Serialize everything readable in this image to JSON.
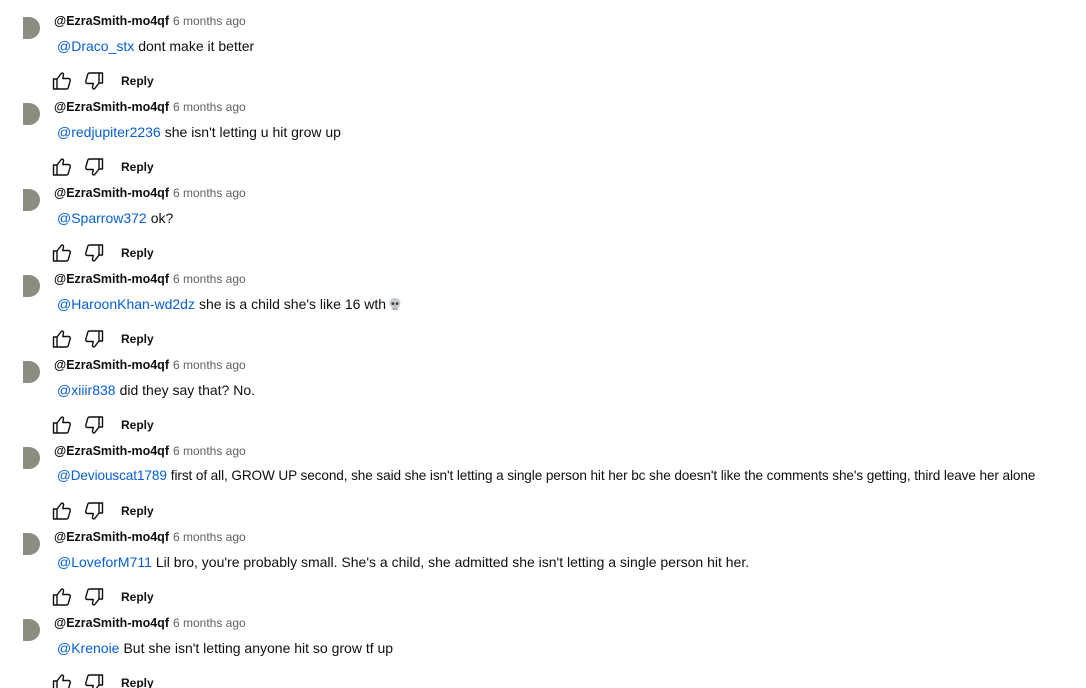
{
  "comments": [
    {
      "author": "@EzraSmith-mo4qf",
      "time": "6 months ago",
      "mention": "@Draco_stx",
      "text": "dont make it better",
      "emoji": "",
      "reply": "Reply"
    },
    {
      "author": "@EzraSmith-mo4qf",
      "time": "6 months ago",
      "mention": "@redjupiter2236",
      "text": "she isn't letting u hit grow up",
      "emoji": "",
      "reply": "Reply"
    },
    {
      "author": "@EzraSmith-mo4qf",
      "time": "6 months ago",
      "mention": "@Sparrow372",
      "text": "ok?",
      "emoji": "",
      "reply": "Reply"
    },
    {
      "author": "@EzraSmith-mo4qf",
      "time": "6 months ago",
      "mention": "@HaroonKhan-wd2dz",
      "text": "she is a child she's like 16 wth",
      "emoji": "skull-emoji",
      "reply": "Reply"
    },
    {
      "author": "@EzraSmith-mo4qf",
      "time": "6 months ago",
      "mention": "@xiiir838",
      "text": "did they say that? No.",
      "emoji": "",
      "reply": "Reply"
    },
    {
      "author": "@EzraSmith-mo4qf",
      "time": "6 months ago",
      "mention": "@Deviouscat1789",
      "text": "first of all, GROW UP second, she said she isn't letting a single person hit her bc she doesn't like the comments she's getting, third leave her alone",
      "emoji": "",
      "reply": "Reply"
    },
    {
      "author": "@EzraSmith-mo4qf",
      "time": "6 months ago",
      "mention": "@LoveforM711",
      "text": "Lil bro, you're probably small. She's a child, she admitted she isn't letting a single person hit her.",
      "emoji": "",
      "reply": "Reply"
    },
    {
      "author": "@EzraSmith-mo4qf",
      "time": "6 months ago",
      "mention": "@Krenoie",
      "text": "But she isn't letting anyone hit so grow tf up",
      "emoji": "",
      "reply": "Reply"
    }
  ],
  "colors": {
    "mention": "#065fd4",
    "avatar": "#8c8c80",
    "text": "#0f0f0f",
    "meta": "#606060"
  },
  "icons": {
    "like": "thumbs-up-icon",
    "dislike": "thumbs-down-icon",
    "avatar": "avatar"
  }
}
